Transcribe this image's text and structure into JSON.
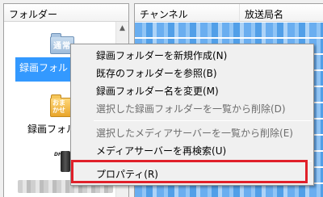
{
  "left_pane": {
    "header": "フォルダー",
    "folders": [
      {
        "icon_label": "通常",
        "name": "録画フォル"
      },
      {
        "icon_label": "おま\nかせ",
        "name": "録画フォル"
      }
    ],
    "device_icon_label": "DH"
  },
  "right_pane": {
    "columns": [
      "チャンネル",
      "放送局名"
    ]
  },
  "context_menu": {
    "items": [
      {
        "label": "録画フォルダーを新規作成(N)",
        "enabled": true
      },
      {
        "label": "既存のフォルダーを参照(B)",
        "enabled": true
      },
      {
        "label": "録画フォルダー名を変更(M)",
        "enabled": true
      },
      {
        "label": "選択した録画フォルダーを一覧から削除(D)",
        "enabled": false
      },
      {
        "label": "選択したメディアサーバーを一覧から削除(E)",
        "enabled": false
      },
      {
        "label": "メディアサーバーを再検索(U)",
        "enabled": true
      },
      {
        "label": "プロパティ(R)",
        "enabled": true
      }
    ],
    "highlight_color": "#e0202a"
  },
  "colors": {
    "selection": "#3399ff",
    "menu_background": "#f0f0f0"
  }
}
